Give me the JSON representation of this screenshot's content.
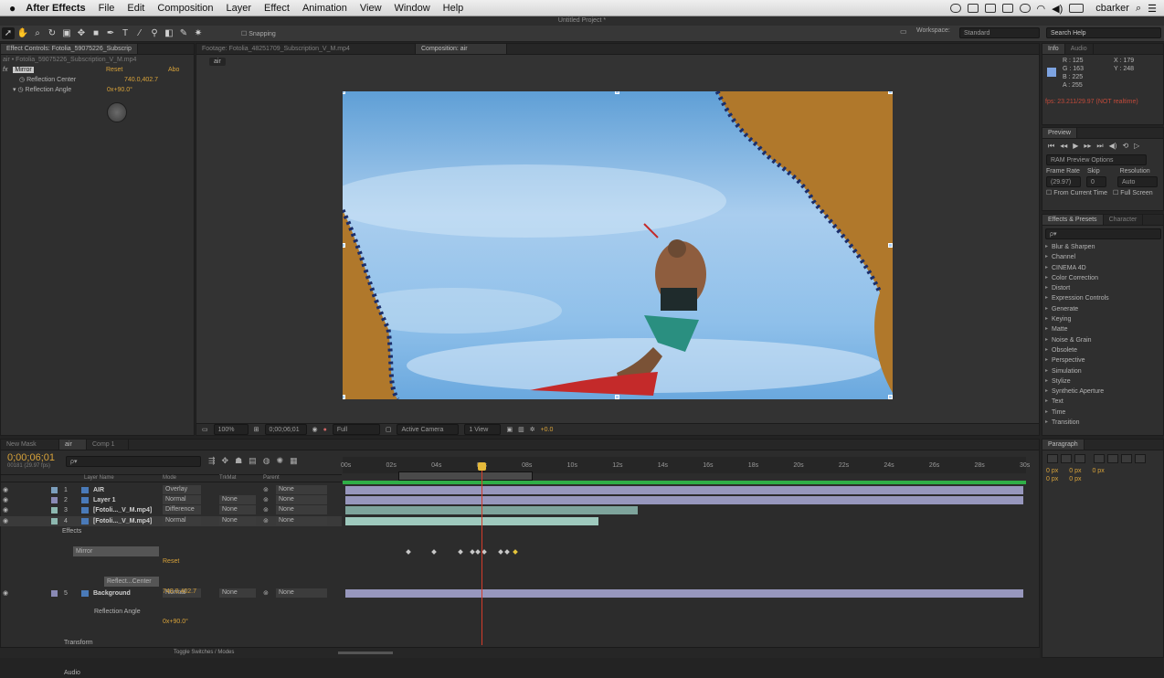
{
  "menubar": {
    "app": "After Effects",
    "items": [
      "File",
      "Edit",
      "Composition",
      "Layer",
      "Effect",
      "Animation",
      "View",
      "Window",
      "Help"
    ],
    "user": "cbarker"
  },
  "title": "Untitled Project *",
  "toolbar": {
    "snapping": "Snapping",
    "workspace_label": "Workspace:",
    "workspace_value": "Standard",
    "search_placeholder": "Search Help"
  },
  "effect_controls": {
    "tab": "Effect Controls: Fotolia_59075226_Subscrip",
    "layer_path": "air • Fotolia_59075226_Subscription_V_M.mp4",
    "effect_name": "Mirror",
    "reset": "Reset",
    "about": "Abo",
    "prop1_label": "Reflection Center",
    "prop1_value": "740.0,402.7",
    "prop2_label": "Reflection Angle",
    "prop2_value": "0x+90.0°"
  },
  "comp_tabs": {
    "footage": "Footage: Fotolia_48251709_Subscription_V_M.mp4",
    "composition": "Composition: air",
    "crumb": "air"
  },
  "comp_footer": {
    "zoom": "100%",
    "time": "0;00;06;01",
    "resolution": "Full",
    "camera": "Active Camera",
    "views": "1 View",
    "exposure": "+0.0"
  },
  "info": {
    "tabs": [
      "Info",
      "Audio"
    ],
    "r": "R : 125",
    "g": "G : 163",
    "b": "B : 225",
    "a": "A : 255",
    "x": "X : 179",
    "y": "Y : 248",
    "fps": "fps: 23.211/29.97 (NOT realtime)"
  },
  "preview": {
    "tab": "Preview",
    "ram": "RAM Preview Options",
    "frame_rate_label": "Frame Rate",
    "skip_label": "Skip",
    "resolution_label": "Resolution",
    "frame_rate": "(29.97)",
    "skip": "0",
    "resolution": "Auto",
    "from_current": "From Current Time",
    "full_screen": "Full Screen"
  },
  "effects_presets": {
    "tabs": [
      "Effects & Presets",
      "Character"
    ],
    "search": "ρ▾",
    "items": [
      "Blur & Sharpen",
      "Channel",
      "CINEMA 4D",
      "Color Correction",
      "Distort",
      "Expression Controls",
      "Generate",
      "Keying",
      "Matte",
      "Noise & Grain",
      "Obsolete",
      "Perspective",
      "Simulation",
      "Stylize",
      "Synthetic Aperture",
      "Text",
      "Time",
      "Transition"
    ]
  },
  "paragraph": {
    "tab": "Paragraph",
    "indent_values": [
      "0 px",
      "0 px",
      "0 px",
      "0 px",
      "0 px"
    ]
  },
  "timeline": {
    "tabs": [
      "New Mask",
      "air",
      "Comp 1"
    ],
    "current_time": "0;00;06;01",
    "frames": "00181 (29.97 fps)",
    "search": "ρ▾",
    "headers": {
      "layer_name": "Layer Name",
      "mode": "Mode",
      "trkmat": "TrkMat",
      "parent": "Parent"
    },
    "ruler": [
      "00s",
      "02s",
      "04s",
      "06s",
      "08s",
      "10s",
      "12s",
      "14s",
      "16s",
      "18s",
      "20s",
      "22s",
      "24s",
      "26s",
      "28s",
      "30s"
    ],
    "layers": [
      {
        "num": "1",
        "name": "AIR",
        "mode": "Overlay",
        "trkmat": "",
        "parent": "None",
        "color": "#7c9fbd"
      },
      {
        "num": "2",
        "name": "Layer 1",
        "mode": "Normal",
        "trkmat": "None",
        "parent": "None",
        "color": "#8a8ab5"
      },
      {
        "num": "3",
        "name": "[Fotoli..._V_M.mp4]",
        "mode": "Difference",
        "trkmat": "None",
        "parent": "None",
        "color": "#8db8b0"
      },
      {
        "num": "4",
        "name": "[Fotoli..._V_M.mp4]",
        "mode": "Normal",
        "trkmat": "None",
        "parent": "None",
        "color": "#8db8b0"
      },
      {
        "num": "5",
        "name": "Background",
        "mode": "Normal",
        "trkmat": "None",
        "parent": "None",
        "color": "#8a8ab5"
      }
    ],
    "effects_label": "Effects",
    "mirror_label": "Mirror",
    "reset": "Reset",
    "reflect_center": "Reflect...Center",
    "reflect_center_value": "740.0,402.7",
    "reflection_angle": "Reflection Angle",
    "reflection_angle_value": "0x+90.0°",
    "transform": "Transform",
    "audio": "Audio",
    "toggle": "Toggle Switches / Modes"
  }
}
